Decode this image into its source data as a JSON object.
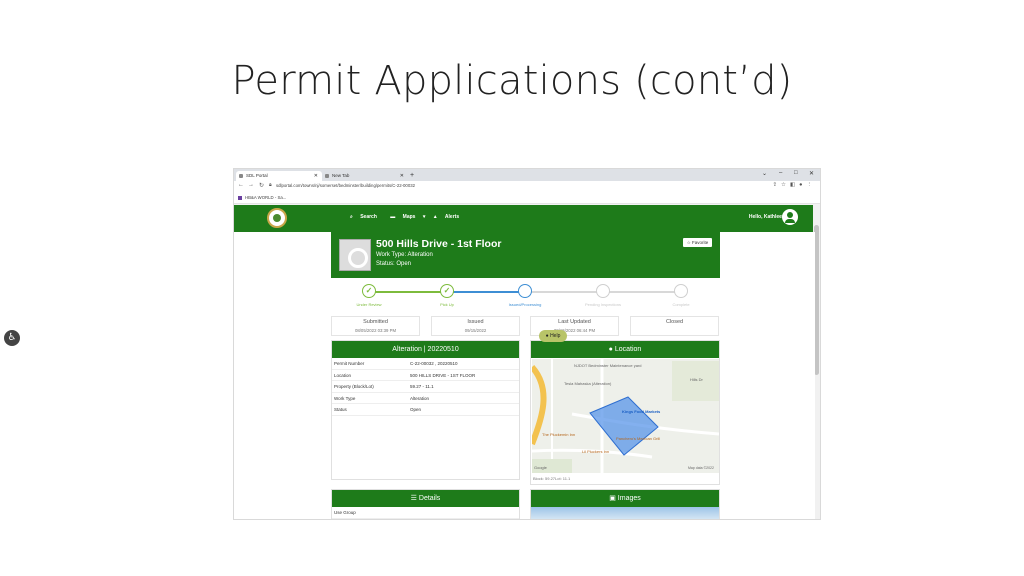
{
  "slide": {
    "title": "Permit Applications (cont’d)"
  },
  "browser": {
    "tabs": [
      {
        "label": "SDL Portal"
      },
      {
        "label": "New Tab"
      }
    ],
    "new_tab": "+",
    "url": "sdlportal.com/towns/nj/somerset/bedminster/building/permits/C-22-00032",
    "bookmark": "HB&A WORLD - Sa...",
    "window_controls": [
      "⌄",
      "–",
      "□",
      "✕"
    ]
  },
  "app": {
    "nav": {
      "search": "Search",
      "maps": "Maps",
      "alerts": "Alerts"
    },
    "greeting": "Hello, Kathleen",
    "header": {
      "title": "500 Hills Drive - 1st Floor",
      "work_type": "Work Type: Alteration",
      "status": "Status: Open",
      "favorite": "Favorite"
    },
    "steps": [
      {
        "label": "Under Review",
        "state": "done"
      },
      {
        "label": "Pick Up",
        "state": "done"
      },
      {
        "label": "Issued/Processing",
        "state": "current"
      },
      {
        "label": "Pending Inspections",
        "state": "todo"
      },
      {
        "label": "Complete",
        "state": "todo"
      }
    ],
    "dates": [
      {
        "label": "Submitted",
        "value": "08/05/2022 03:39 PM"
      },
      {
        "label": "Issued",
        "value": "09/15/2022"
      },
      {
        "label": "Last Updated",
        "value": "09/15/2022 06:44 PM"
      },
      {
        "label": "Closed",
        "value": ""
      }
    ],
    "permit_panel": {
      "title": "Alteration | 20220510",
      "rows": [
        {
          "key": "Permit Number",
          "value": "C-22-00032 , 20220510"
        },
        {
          "key": "Location",
          "value": "500 HILLS DRIVE - 1ST FLOOR"
        },
        {
          "key": "Property (Block/Lot)",
          "value": "59.27 - 11.1"
        },
        {
          "key": "Work Type",
          "value": "Alteration"
        },
        {
          "key": "Status",
          "value": "Open"
        }
      ]
    },
    "location_panel": {
      "title": "Location",
      "caption": "Block: 59.27Lot: 11.1",
      "map_labels": [
        "NJDOT Bedminster Maintenance yard",
        "Tesla Mahaska (Alteration)",
        "Kings Food Markets",
        "The Pluckemin Inn",
        "Panchero's Mexican Grill",
        "Lil Pluckers Inn",
        "Hills Dr",
        "Google",
        "Map data ©2022"
      ]
    },
    "details_panel": {
      "title": "Details",
      "rows": [
        {
          "key": "Use Group"
        }
      ]
    },
    "images_panel": {
      "title": "Images"
    },
    "help": "Help"
  }
}
